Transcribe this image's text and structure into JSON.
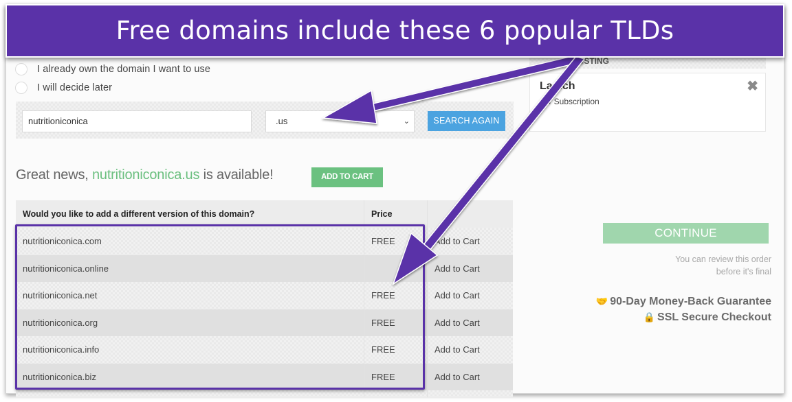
{
  "banner": {
    "title": "Free domains include these 6 popular TLDs"
  },
  "domain_options": [
    {
      "label": "I already own the domain I want to use",
      "selected": false
    },
    {
      "label": "I will decide later",
      "selected": false
    }
  ],
  "search": {
    "domain_value": "nutritioniconica",
    "tld_selected": ".us",
    "search_button": "SEARCH AGAIN"
  },
  "availability": {
    "prefix": "Great news, ",
    "domain": "nutritioniconica.us",
    "suffix": " is available!",
    "add_button": "ADD TO CART"
  },
  "table": {
    "headers": [
      "Would you like to add a different version of this domain?",
      "Price",
      ""
    ],
    "rows": [
      {
        "domain": "nutritioniconica.com",
        "price": "FREE",
        "action": "Add to Cart"
      },
      {
        "domain": "nutritioniconica.online",
        "price": "",
        "action": "Add to Cart"
      },
      {
        "domain": "nutritioniconica.net",
        "price": "FREE",
        "action": "Add to Cart"
      },
      {
        "domain": "nutritioniconica.org",
        "price": "FREE",
        "action": "Add to Cart"
      },
      {
        "domain": "nutritioniconica.info",
        "price": "FREE",
        "action": "Add to Cart"
      },
      {
        "domain": "nutritioniconica.biz",
        "price": "FREE",
        "action": "Add to Cart"
      }
    ]
  },
  "sidebar": {
    "section_header": "OSTING",
    "plan_name": "La  nch",
    "plan_sub": "ear Subscription",
    "close_icon": "✖",
    "continue_button": "CONTINUE",
    "review_note_line1": "You can review this order",
    "review_note_line2": "before it's final",
    "guarantee": "90-Day Money-Back Guarantee",
    "secure": "SSL Secure Checkout",
    "guarantee_icon": "handshake-icon",
    "secure_icon": "lock-icon"
  },
  "colors": {
    "accent_purple": "#5a32a8",
    "search_blue": "#4ba3e0",
    "success_green": "#6bc180",
    "continue_green": "#a0d6ad"
  }
}
